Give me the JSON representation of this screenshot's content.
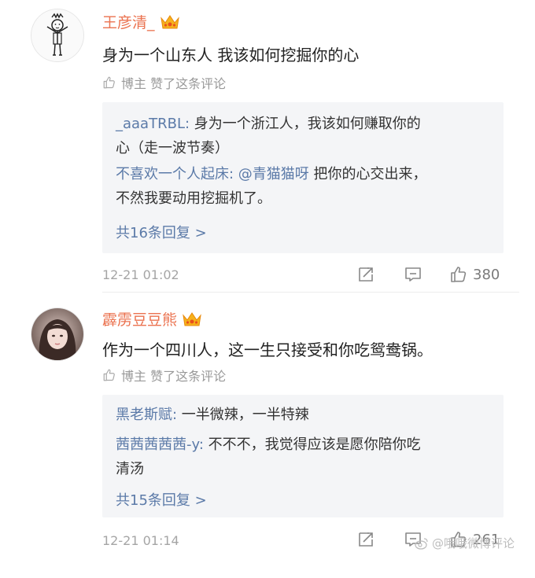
{
  "comments": [
    {
      "username": "王彦清_",
      "content": "身为一个山东人 我该如何挖掘你的心",
      "liked_by_author": "博主 赞了这条评论",
      "replies": [
        {
          "who": "_aaaTRBL:",
          "text_1": " 身为一个浙江人，我该如何赚取你的",
          "text_2": "心（走一波节奏）"
        },
        {
          "who": "不喜欢一个人起床:",
          "at": " @青猫猫呀",
          "text_1": " 把你的心交出来，",
          "text_2": "不然我要动用挖掘机了。"
        }
      ],
      "more_replies": "共16条回复 >",
      "time": "12-21 01:02",
      "like_count": "380"
    },
    {
      "username": "霹雳豆豆熊",
      "content": "作为一个四川人，这一生只接受和你吃鸳鸯锅。",
      "liked_by_author": "博主 赞了这条评论",
      "replies": [
        {
          "who": "黑老斯赋:",
          "text_1": " 一半微辣，一半特辣"
        },
        {
          "who": "茜茜茜茜茜-y:",
          "text_1": " 不不不，我觉得应该是愿你陪你吃",
          "text_2": "清汤"
        }
      ],
      "more_replies": "共15条回复 >",
      "time": "12-21 01:14",
      "like_count": "261"
    }
  ],
  "watermark": "@哦哦微博评论",
  "colors": {
    "username": "#eb7350",
    "link": "#5b7aa8",
    "meta": "#999999",
    "reply_bg": "#f4f5f7"
  }
}
